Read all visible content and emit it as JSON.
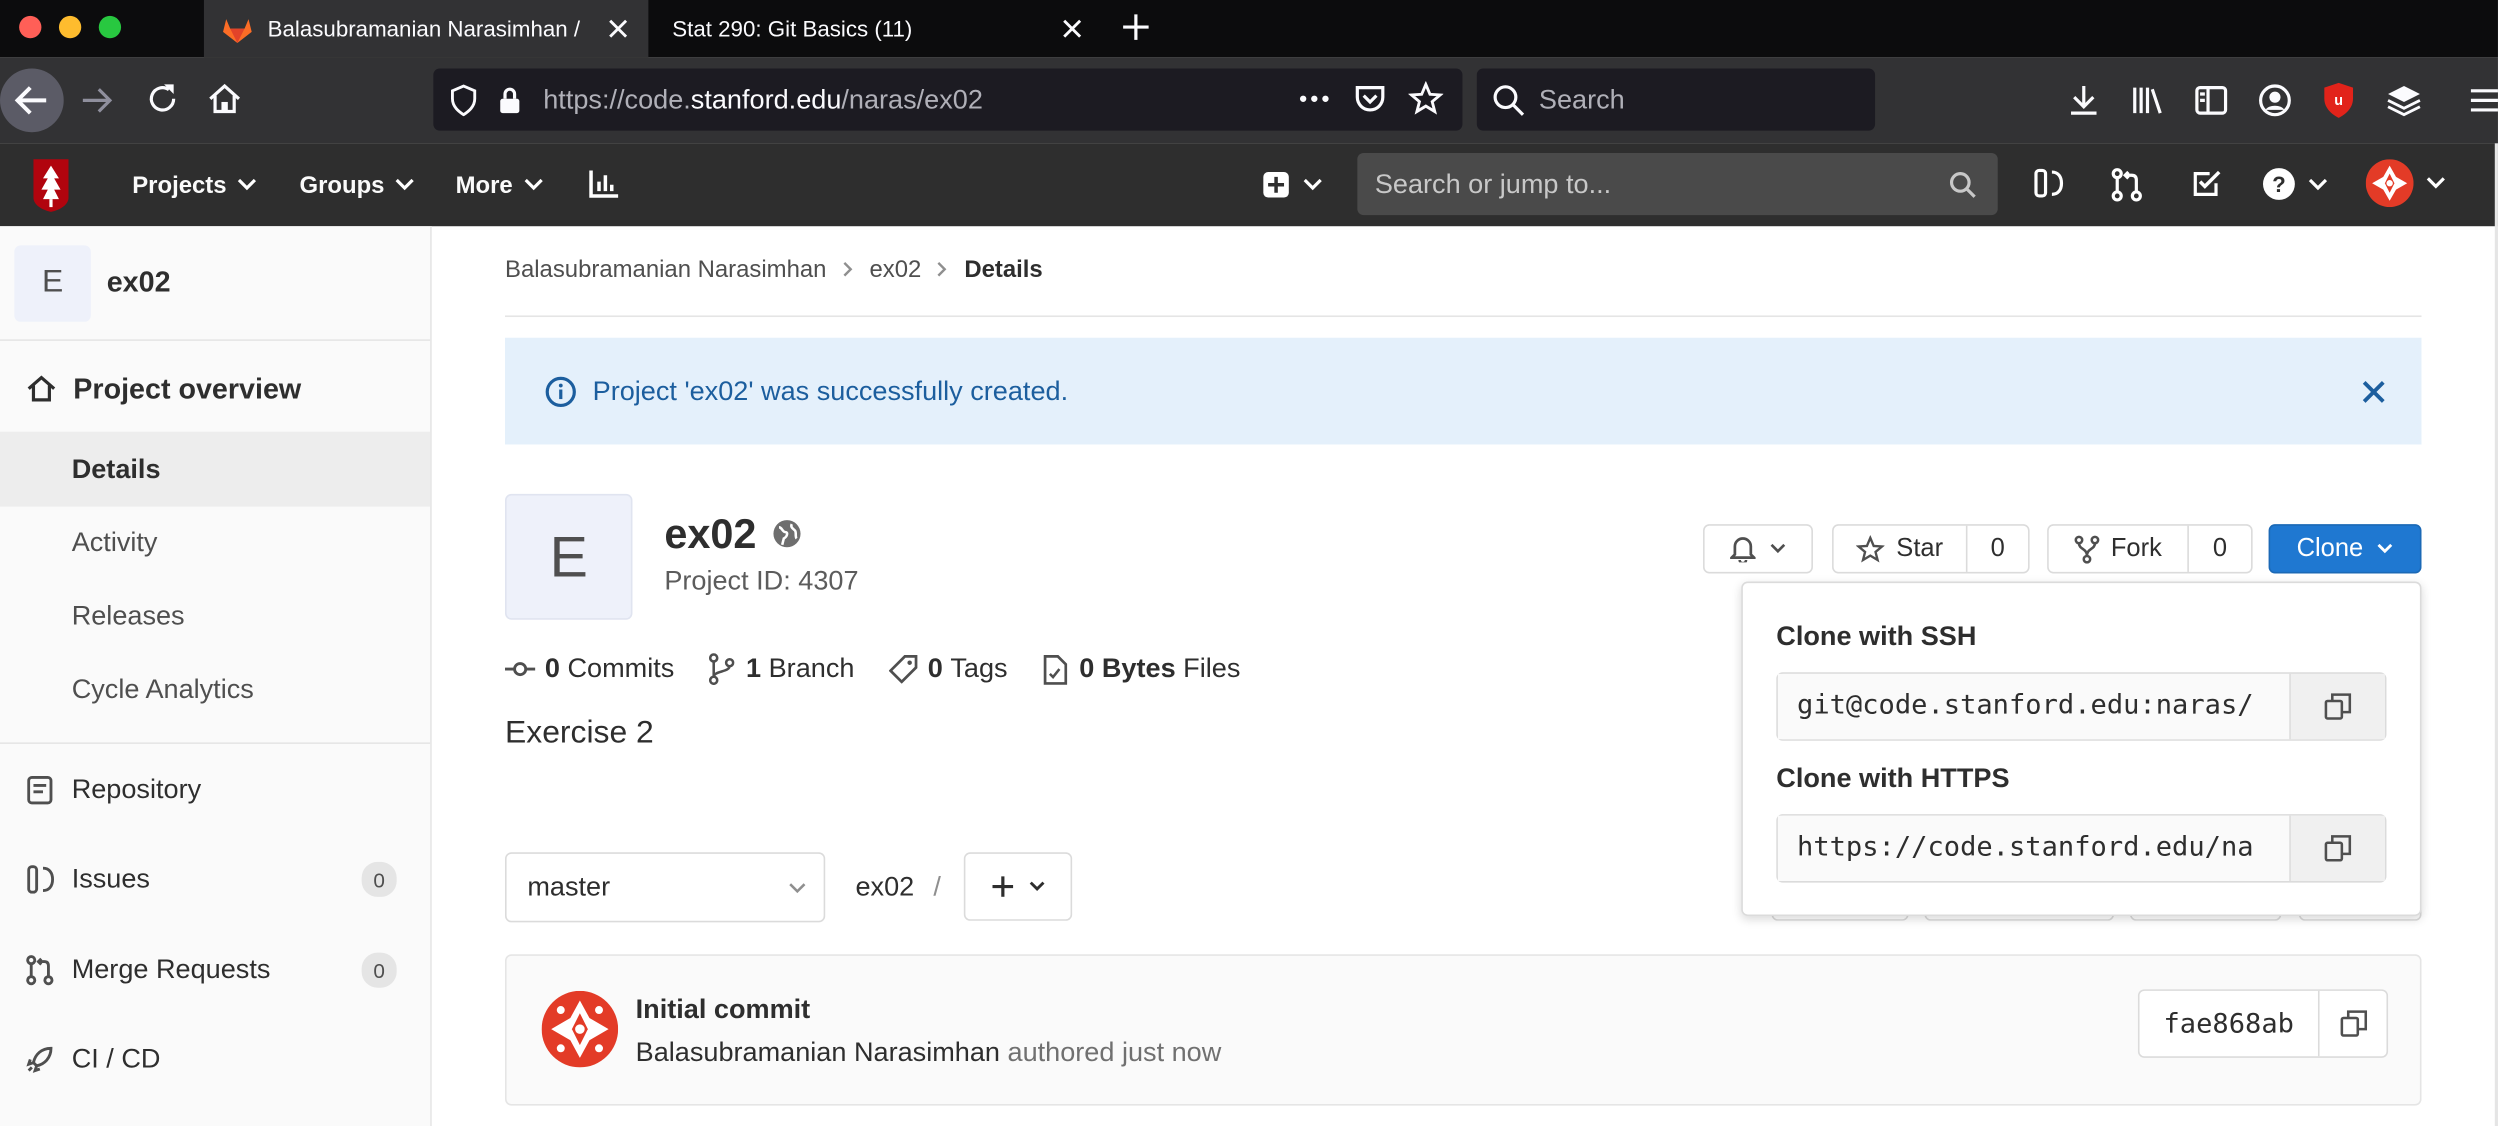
{
  "browser": {
    "tabs": [
      {
        "label": "Balasubramanian Narasimhan /"
      },
      {
        "label": "Stat 290: Git Basics (11)"
      }
    ],
    "url": {
      "prefix": "https://code.",
      "domain": "stanford.edu",
      "path": "/naras/ex02"
    },
    "search_placeholder": "Search"
  },
  "gitlab_nav": {
    "items": [
      "Projects",
      "Groups",
      "More"
    ],
    "search_placeholder": "Search or jump to..."
  },
  "sidebar": {
    "project_initial": "E",
    "project_name": "ex02",
    "section": "Project overview",
    "sub_items": [
      "Details",
      "Activity",
      "Releases",
      "Cycle Analytics"
    ],
    "items": [
      {
        "label": "Repository",
        "badge": ""
      },
      {
        "label": "Issues",
        "badge": "0"
      },
      {
        "label": "Merge Requests",
        "badge": "0"
      },
      {
        "label": "CI / CD",
        "badge": ""
      }
    ]
  },
  "breadcrumb": {
    "owner": "Balasubramanian Narasimhan",
    "project": "ex02",
    "current": "Details"
  },
  "alert": {
    "message": "Project 'ex02' was successfully created."
  },
  "project": {
    "initial": "E",
    "name": "ex02",
    "id_text": "Project ID: 4307",
    "description": "Exercise 2",
    "stats": {
      "commits_count": "0",
      "commits_label": "Commits",
      "branch_count": "1",
      "branch_label": "Branch",
      "tags_count": "0",
      "tags_label": "Tags",
      "bytes_count": "0 Bytes",
      "bytes_label": "Files"
    }
  },
  "actions": {
    "star_label": "Star",
    "star_count": "0",
    "fork_label": "Fork",
    "fork_count": "0",
    "clone_label": "Clone"
  },
  "clone_dropdown": {
    "ssh_label": "Clone with SSH",
    "ssh_url": "git@code.stanford.edu:naras/",
    "https_label": "Clone with HTTPS",
    "https_url": "https://code.stanford.edu/na"
  },
  "repo": {
    "branch": "master",
    "path": "ex02",
    "separator": "/"
  },
  "commit": {
    "title": "Initial commit",
    "author": "Balasubramanian Narasimhan",
    "meta": "authored just now",
    "sha": "fae868ab"
  },
  "colors": {
    "primary": "#1f78d1",
    "alert_bg": "#e4f0fb",
    "alert_text": "#1c5e9e",
    "nav_bg": "#2e2e2e",
    "avatar_red": "#e33b27",
    "stanford_red": "#b1040e"
  }
}
